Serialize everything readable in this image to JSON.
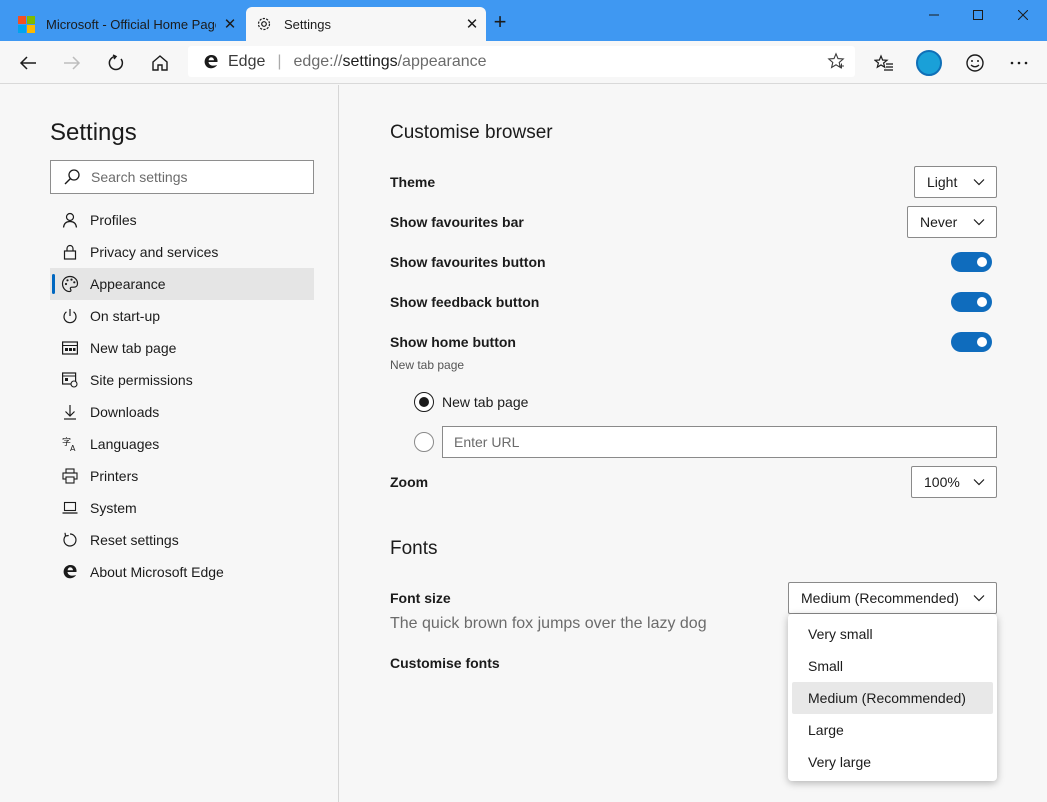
{
  "tabs": [
    {
      "title": "Microsoft - Official Home Page",
      "icon": "microsoft-logo-icon"
    },
    {
      "title": "Settings",
      "icon": "gear-icon"
    }
  ],
  "address": {
    "site_label": "Edge",
    "url_prefix": "edge://",
    "url_main": "settings",
    "url_path": "/appearance"
  },
  "colors": {
    "titlebar": "#3f98f2",
    "accent": "#0f6cbd",
    "active_indicator": "#0067c0"
  },
  "sidebar": {
    "title": "Settings",
    "search_placeholder": "Search settings",
    "items": [
      {
        "label": "Profiles",
        "icon": "person-icon"
      },
      {
        "label": "Privacy and services",
        "icon": "lock-icon"
      },
      {
        "label": "Appearance",
        "icon": "palette-icon",
        "active": true
      },
      {
        "label": "On start-up",
        "icon": "power-icon"
      },
      {
        "label": "New tab page",
        "icon": "newtab-icon"
      },
      {
        "label": "Site permissions",
        "icon": "site-permissions-icon"
      },
      {
        "label": "Downloads",
        "icon": "download-icon"
      },
      {
        "label": "Languages",
        "icon": "languages-icon"
      },
      {
        "label": "Printers",
        "icon": "printer-icon"
      },
      {
        "label": "System",
        "icon": "laptop-icon"
      },
      {
        "label": "Reset settings",
        "icon": "reset-icon"
      },
      {
        "label": "About Microsoft Edge",
        "icon": "edge-logo-icon"
      }
    ]
  },
  "main": {
    "customise_heading": "Customise browser",
    "theme": {
      "label": "Theme",
      "value": "Light"
    },
    "favourites_bar": {
      "label": "Show favourites bar",
      "value": "Never"
    },
    "favourites_button": {
      "label": "Show favourites button",
      "on": true
    },
    "feedback_button": {
      "label": "Show feedback button",
      "on": true
    },
    "home_button": {
      "label": "Show home button",
      "sub": "New tab page",
      "on": true
    },
    "home_options": {
      "option1": "New tab page",
      "url_placeholder": "Enter URL"
    },
    "zoom": {
      "label": "Zoom",
      "value": "100%"
    },
    "fonts_heading": "Fonts",
    "font_size": {
      "label": "Font size",
      "value": "Medium (Recommended)",
      "sample": "The quick brown fox jumps over the lazy dog"
    },
    "customise_fonts": "Customise fonts"
  },
  "font_size_menu": {
    "options": [
      "Very small",
      "Small",
      "Medium (Recommended)",
      "Large",
      "Very large"
    ],
    "selected": "Medium (Recommended)"
  }
}
